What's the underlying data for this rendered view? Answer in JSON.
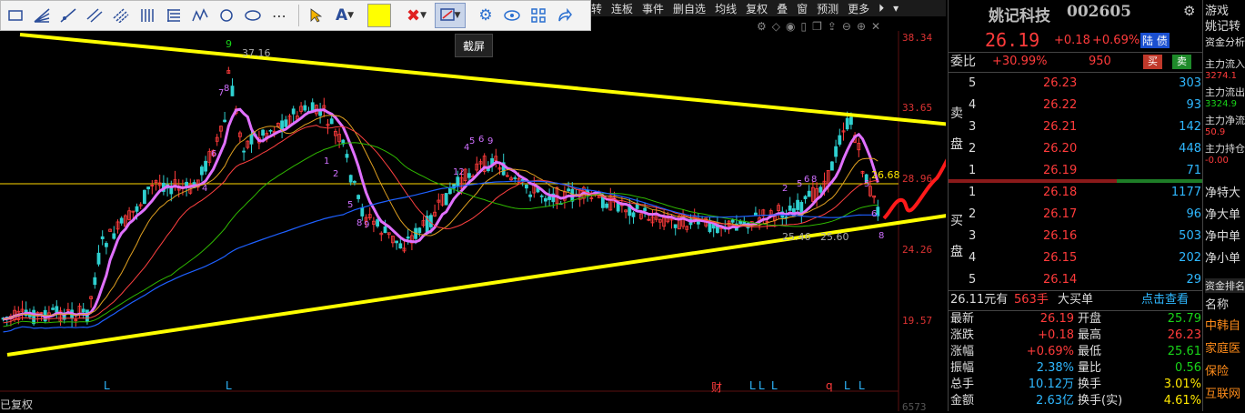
{
  "toolbar": {
    "tools": [
      "rect-tool",
      "fan-tool",
      "ray-tool",
      "parallel-tool",
      "channel-tool",
      "vertical-lines-tool",
      "fib-tool",
      "wave-tool",
      "circle-tool",
      "ellipse-tool",
      "more-tool"
    ],
    "more_glyph": "⋯",
    "text_glyph": "A",
    "color_swatch": "#ffff00",
    "tooltip": "截屏"
  },
  "menu": [
    "转",
    "连板",
    "事件",
    "删自选",
    "均线",
    "复权",
    "叠",
    "窗",
    "预测",
    "更多"
  ],
  "chart": {
    "price_labels": [
      "38.34",
      "33.65",
      "28.96",
      "24.26",
      "19.57",
      "6573"
    ],
    "annotations": {
      "peak_price": "37.16",
      "current_price": "26.68",
      "low_price": "25.46",
      "low_price_2": "25.60",
      "top_marker": "9"
    },
    "bottom_markers": [
      "L",
      "L",
      "财",
      "L",
      "L",
      "L",
      "q",
      "L",
      "L"
    ],
    "footer": "已复权",
    "top_icons": [
      "settings-icon",
      "eye-icon",
      "trash-icon",
      "copy-icon",
      "export-icon",
      "minus-icon",
      "plus-icon",
      "close-icon"
    ]
  },
  "stock": {
    "name": "姚记科技",
    "code": "002605",
    "price": "26.19",
    "change": "+0.18",
    "change_pct": "+0.69%",
    "tag": "陆 债"
  },
  "order_book": {
    "weibi_label": "委比",
    "weibi_value": "+30.99%",
    "weicha_value": "950",
    "buy_label": "买",
    "sell_label": "卖",
    "sell_side_label": "卖盘",
    "buy_side_label": "买盘",
    "sell": [
      {
        "level": "5",
        "price": "26.23",
        "vol": "303"
      },
      {
        "level": "4",
        "price": "26.22",
        "vol": "93"
      },
      {
        "level": "3",
        "price": "26.21",
        "vol": "142"
      },
      {
        "level": "2",
        "price": "26.20",
        "vol": "448"
      },
      {
        "level": "1",
        "price": "26.19",
        "vol": "71"
      }
    ],
    "buy": [
      {
        "level": "1",
        "price": "26.18",
        "vol": "1177"
      },
      {
        "level": "2",
        "price": "26.17",
        "vol": "96"
      },
      {
        "level": "3",
        "price": "26.16",
        "vol": "503"
      },
      {
        "level": "4",
        "price": "26.15",
        "vol": "202"
      },
      {
        "level": "5",
        "price": "26.14",
        "vol": "29"
      }
    ]
  },
  "big_order": {
    "price": "26.11元有",
    "vol": "563手",
    "label": "大买单",
    "link": "点击查看"
  },
  "stats": [
    {
      "l1": "最新",
      "v1": "26.19",
      "c1": "red",
      "l2": "开盘",
      "v2": "25.79",
      "c2": "green"
    },
    {
      "l1": "涨跌",
      "v1": "+0.18",
      "c1": "red",
      "l2": "最高",
      "v2": "26.23",
      "c2": "red"
    },
    {
      "l1": "涨幅",
      "v1": "+0.69%",
      "c1": "red",
      "l2": "最低",
      "v2": "25.61",
      "c2": "green"
    },
    {
      "l1": "振幅",
      "v1": "2.38%",
      "c1": "cyan",
      "l2": "量比",
      "v2": "0.56",
      "c2": "green"
    },
    {
      "l1": "总手",
      "v1": "10.12万",
      "c1": "cyan",
      "l2": "换手",
      "v2": "3.01%",
      "c2": "yellow"
    },
    {
      "l1": "金额",
      "v1": "2.63亿",
      "c1": "cyan",
      "l2": "换手(实)",
      "v2": "4.61%",
      "c2": "yellow"
    }
  ],
  "side": {
    "title1": "游戏",
    "title2": "姚记转",
    "tab": "资金分析",
    "flows": [
      {
        "label": "主力流入",
        "value": "3274.1"
      },
      {
        "label": "主力流出",
        "value": "3324.9"
      },
      {
        "label": "主力净流",
        "value": "50.9"
      },
      {
        "label": "主力持仓",
        "value": "-0.00"
      }
    ],
    "net_items": [
      "净特大",
      "净大单",
      "净中单",
      "净小单"
    ],
    "rank_tab": "资金排名",
    "rank_header": "名称",
    "rank_items": [
      "中韩自",
      "家庭医",
      "保险",
      "互联网"
    ]
  },
  "colors": {
    "up": "#ff3b3b",
    "down": "#19d419",
    "trend_line": "#ffff00",
    "ma_main": "#e070ff",
    "annotation_red": "#ff1a1a"
  }
}
